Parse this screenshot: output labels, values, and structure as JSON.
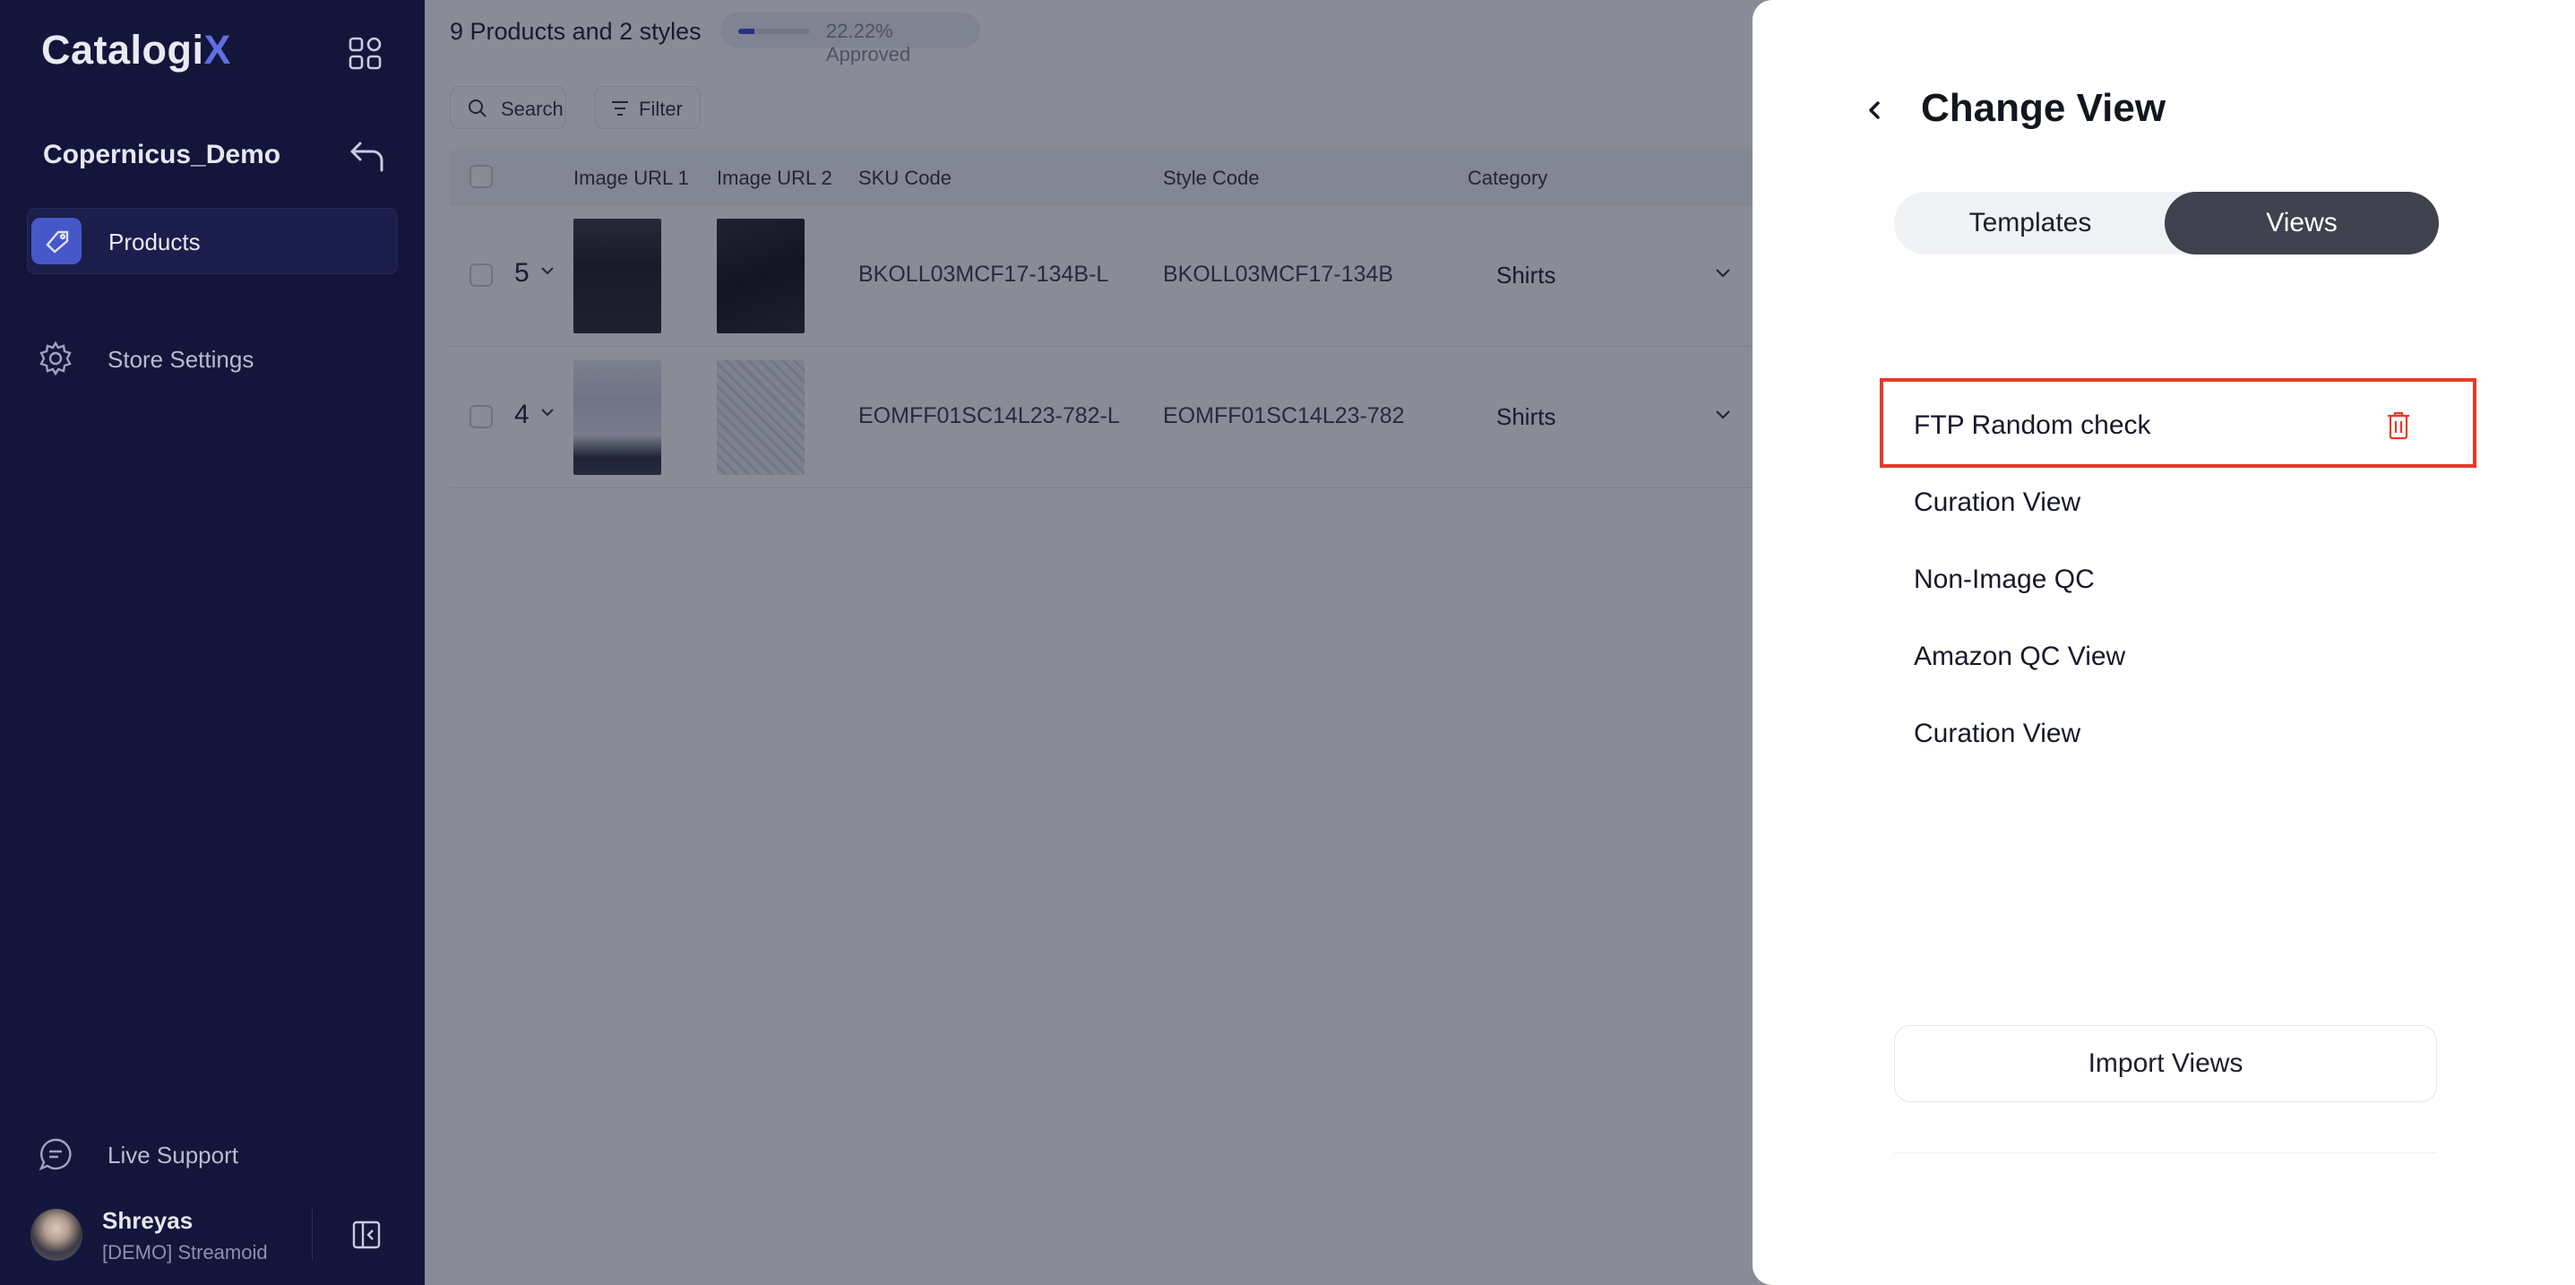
{
  "brand": {
    "logo_main": "Catalogi",
    "logo_accent": "X",
    "accent_color": "#5f6fe0"
  },
  "sidebar": {
    "workspace": "Copernicus_Demo",
    "items": [
      {
        "label": "Products",
        "icon": "tag-icon",
        "active": true
      },
      {
        "label": "Store Settings",
        "icon": "gear-icon",
        "active": false
      }
    ],
    "live_support": "Live Support",
    "user": {
      "name": "Shreyas",
      "org": "[DEMO] Streamoid"
    }
  },
  "topbar": {
    "title": "9 Products and 2 styles",
    "approved_text": "22.22% Approved",
    "approved_fraction": 0.2222
  },
  "toolbar": {
    "search_label": "Search",
    "filter_label": "Filter"
  },
  "table": {
    "headers": [
      "Image URL 1",
      "Image URL 2",
      "SKU Code",
      "Style Code",
      "Category"
    ],
    "rows": [
      {
        "count": "5",
        "sku": "BKOLL03MCF17-134B-L",
        "style": "BKOLL03MCF17-134B",
        "category": "Shirts"
      },
      {
        "count": "4",
        "sku": "EOMFF01SC14L23-782-L",
        "style": "EOMFF01SC14L23-782",
        "category": "Shirts"
      }
    ]
  },
  "panel": {
    "title": "Change View",
    "tabs": {
      "templates": "Templates",
      "views": "Views",
      "active": "Views"
    },
    "views": [
      "FTP Random check",
      "Curation View",
      "Non-Image QC",
      "Amazon QC View",
      "Curation View"
    ],
    "import_label": "Import Views",
    "highlight_color": "#e63a2a"
  }
}
